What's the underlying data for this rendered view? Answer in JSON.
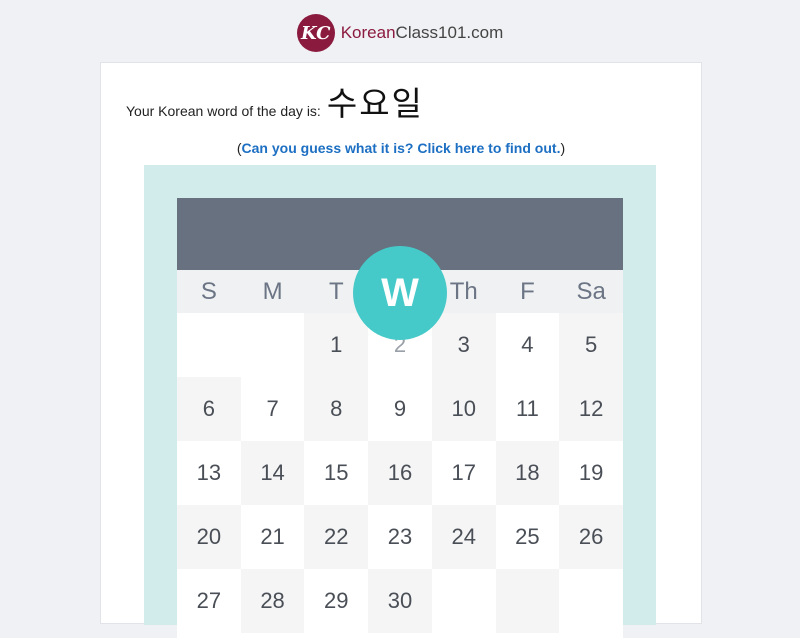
{
  "logo": {
    "mark": "KC",
    "brand_part1": "Korean",
    "brand_part2": "Class101.com",
    "brand_color": "#8b1a3f"
  },
  "wod": {
    "label": "Your Korean word of the day is:",
    "word": "수요일"
  },
  "hint": {
    "open": "(",
    "link": "Can you guess what it is? Click here to find out.",
    "close": ")"
  },
  "calendar": {
    "badge": "W",
    "badge_color": "#45c9c9",
    "header_color": "#67717f",
    "days_of_week": [
      "S",
      "M",
      "T",
      "W",
      "Th",
      "F",
      "Sa"
    ],
    "weeks": [
      [
        "",
        "",
        "1",
        "2",
        "3",
        "4",
        "5"
      ],
      [
        "6",
        "7",
        "8",
        "9",
        "10",
        "11",
        "12"
      ],
      [
        "13",
        "14",
        "15",
        "16",
        "17",
        "18",
        "19"
      ],
      [
        "20",
        "21",
        "22",
        "23",
        "24",
        "25",
        "26"
      ],
      [
        "27",
        "28",
        "29",
        "30",
        "",
        "",
        ""
      ]
    ]
  }
}
